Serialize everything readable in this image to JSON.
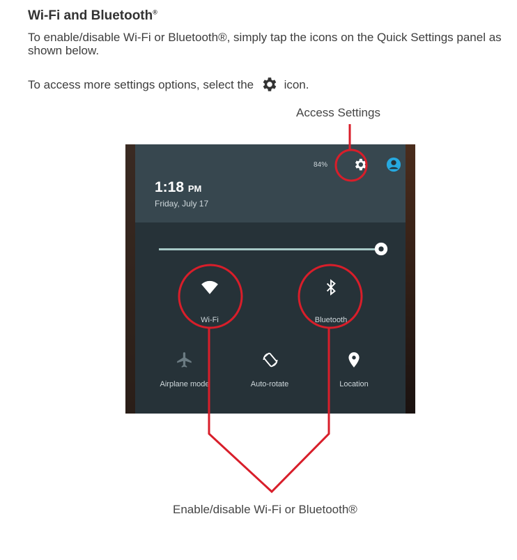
{
  "doc": {
    "heading": "Wi-Fi and Bluetooth",
    "heading_mark": "®",
    "para1": "To enable/disable Wi-Fi or Bluetooth®, simply tap the icons on the Quick Settings panel as shown below.",
    "para2_before": "To access more settings options, select the",
    "para2_after": "icon.",
    "callout_top": "Access Settings",
    "callout_bottom": "Enable/disable Wi-Fi or Bluetooth®"
  },
  "screen": {
    "battery": "84%",
    "time": "1:18",
    "ampm": "PM",
    "date": "Friday, July 17",
    "tiles": [
      {
        "label": "Wi-Fi",
        "icon": "wifi-icon"
      },
      {
        "label": "Bluetooth",
        "icon": "bluetooth-icon"
      },
      {
        "label": "Airplane mode",
        "icon": "airplane-icon"
      },
      {
        "label": "Auto-rotate",
        "icon": "auto-rotate-icon"
      },
      {
        "label": "Location",
        "icon": "location-icon"
      }
    ]
  },
  "colors": {
    "callout_red": "#d81e2a",
    "panel_bg": "#263238",
    "header_bg": "#37474f",
    "accent": "#26a9e0"
  }
}
